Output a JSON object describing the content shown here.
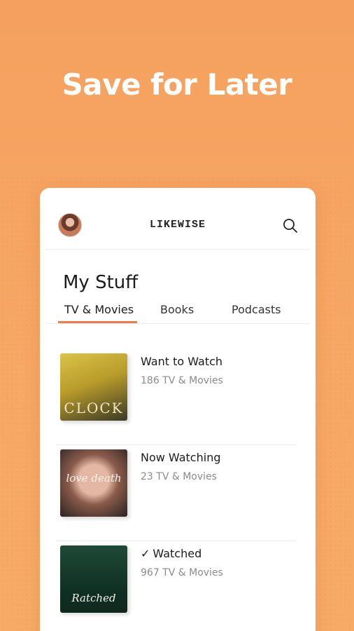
{
  "headline": "Save for Later",
  "app": {
    "brand": "LIKEWISE",
    "avatar_icon": "avatar",
    "search_icon": "search-icon"
  },
  "page": {
    "title": "My Stuff",
    "tabs": [
      {
        "label": "TV & Movies",
        "active": true
      },
      {
        "label": "Books",
        "active": false
      },
      {
        "label": "Podcasts",
        "active": false
      }
    ]
  },
  "lists": [
    {
      "title": "Want to Watch",
      "subtitle": "186 TV & Movies",
      "poster_text": "CLOCK",
      "checked": false
    },
    {
      "title": "Now Watching",
      "subtitle": "23 TV & Movies",
      "poster_text": "love death",
      "checked": false
    },
    {
      "title": "Watched",
      "subtitle": "967 TV & Movies",
      "poster_text": "Ratched",
      "checked": true
    }
  ],
  "colors": {
    "background": "#f5a05e",
    "accent": "#f07a4a",
    "card": "#ffffff"
  }
}
